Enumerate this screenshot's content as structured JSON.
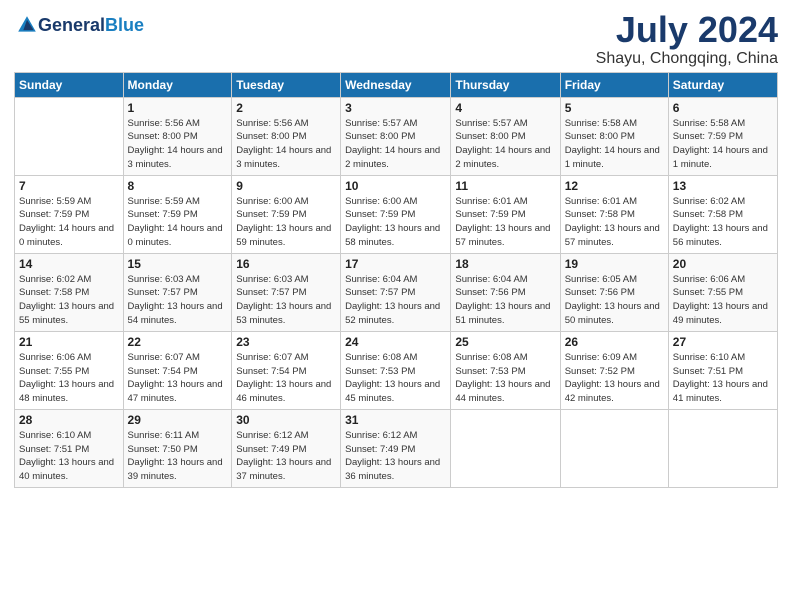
{
  "logo": {
    "text_general": "General",
    "text_blue": "Blue"
  },
  "title": "July 2024",
  "location": "Shayu, Chongqing, China",
  "days_of_week": [
    "Sunday",
    "Monday",
    "Tuesday",
    "Wednesday",
    "Thursday",
    "Friday",
    "Saturday"
  ],
  "weeks": [
    [
      {
        "day": "",
        "sunrise": "",
        "sunset": "",
        "daylight": ""
      },
      {
        "day": "1",
        "sunrise": "Sunrise: 5:56 AM",
        "sunset": "Sunset: 8:00 PM",
        "daylight": "Daylight: 14 hours and 3 minutes."
      },
      {
        "day": "2",
        "sunrise": "Sunrise: 5:56 AM",
        "sunset": "Sunset: 8:00 PM",
        "daylight": "Daylight: 14 hours and 3 minutes."
      },
      {
        "day": "3",
        "sunrise": "Sunrise: 5:57 AM",
        "sunset": "Sunset: 8:00 PM",
        "daylight": "Daylight: 14 hours and 2 minutes."
      },
      {
        "day": "4",
        "sunrise": "Sunrise: 5:57 AM",
        "sunset": "Sunset: 8:00 PM",
        "daylight": "Daylight: 14 hours and 2 minutes."
      },
      {
        "day": "5",
        "sunrise": "Sunrise: 5:58 AM",
        "sunset": "Sunset: 8:00 PM",
        "daylight": "Daylight: 14 hours and 1 minute."
      },
      {
        "day": "6",
        "sunrise": "Sunrise: 5:58 AM",
        "sunset": "Sunset: 7:59 PM",
        "daylight": "Daylight: 14 hours and 1 minute."
      }
    ],
    [
      {
        "day": "7",
        "sunrise": "Sunrise: 5:59 AM",
        "sunset": "Sunset: 7:59 PM",
        "daylight": "Daylight: 14 hours and 0 minutes."
      },
      {
        "day": "8",
        "sunrise": "Sunrise: 5:59 AM",
        "sunset": "Sunset: 7:59 PM",
        "daylight": "Daylight: 14 hours and 0 minutes."
      },
      {
        "day": "9",
        "sunrise": "Sunrise: 6:00 AM",
        "sunset": "Sunset: 7:59 PM",
        "daylight": "Daylight: 13 hours and 59 minutes."
      },
      {
        "day": "10",
        "sunrise": "Sunrise: 6:00 AM",
        "sunset": "Sunset: 7:59 PM",
        "daylight": "Daylight: 13 hours and 58 minutes."
      },
      {
        "day": "11",
        "sunrise": "Sunrise: 6:01 AM",
        "sunset": "Sunset: 7:59 PM",
        "daylight": "Daylight: 13 hours and 57 minutes."
      },
      {
        "day": "12",
        "sunrise": "Sunrise: 6:01 AM",
        "sunset": "Sunset: 7:58 PM",
        "daylight": "Daylight: 13 hours and 57 minutes."
      },
      {
        "day": "13",
        "sunrise": "Sunrise: 6:02 AM",
        "sunset": "Sunset: 7:58 PM",
        "daylight": "Daylight: 13 hours and 56 minutes."
      }
    ],
    [
      {
        "day": "14",
        "sunrise": "Sunrise: 6:02 AM",
        "sunset": "Sunset: 7:58 PM",
        "daylight": "Daylight: 13 hours and 55 minutes."
      },
      {
        "day": "15",
        "sunrise": "Sunrise: 6:03 AM",
        "sunset": "Sunset: 7:57 PM",
        "daylight": "Daylight: 13 hours and 54 minutes."
      },
      {
        "day": "16",
        "sunrise": "Sunrise: 6:03 AM",
        "sunset": "Sunset: 7:57 PM",
        "daylight": "Daylight: 13 hours and 53 minutes."
      },
      {
        "day": "17",
        "sunrise": "Sunrise: 6:04 AM",
        "sunset": "Sunset: 7:57 PM",
        "daylight": "Daylight: 13 hours and 52 minutes."
      },
      {
        "day": "18",
        "sunrise": "Sunrise: 6:04 AM",
        "sunset": "Sunset: 7:56 PM",
        "daylight": "Daylight: 13 hours and 51 minutes."
      },
      {
        "day": "19",
        "sunrise": "Sunrise: 6:05 AM",
        "sunset": "Sunset: 7:56 PM",
        "daylight": "Daylight: 13 hours and 50 minutes."
      },
      {
        "day": "20",
        "sunrise": "Sunrise: 6:06 AM",
        "sunset": "Sunset: 7:55 PM",
        "daylight": "Daylight: 13 hours and 49 minutes."
      }
    ],
    [
      {
        "day": "21",
        "sunrise": "Sunrise: 6:06 AM",
        "sunset": "Sunset: 7:55 PM",
        "daylight": "Daylight: 13 hours and 48 minutes."
      },
      {
        "day": "22",
        "sunrise": "Sunrise: 6:07 AM",
        "sunset": "Sunset: 7:54 PM",
        "daylight": "Daylight: 13 hours and 47 minutes."
      },
      {
        "day": "23",
        "sunrise": "Sunrise: 6:07 AM",
        "sunset": "Sunset: 7:54 PM",
        "daylight": "Daylight: 13 hours and 46 minutes."
      },
      {
        "day": "24",
        "sunrise": "Sunrise: 6:08 AM",
        "sunset": "Sunset: 7:53 PM",
        "daylight": "Daylight: 13 hours and 45 minutes."
      },
      {
        "day": "25",
        "sunrise": "Sunrise: 6:08 AM",
        "sunset": "Sunset: 7:53 PM",
        "daylight": "Daylight: 13 hours and 44 minutes."
      },
      {
        "day": "26",
        "sunrise": "Sunrise: 6:09 AM",
        "sunset": "Sunset: 7:52 PM",
        "daylight": "Daylight: 13 hours and 42 minutes."
      },
      {
        "day": "27",
        "sunrise": "Sunrise: 6:10 AM",
        "sunset": "Sunset: 7:51 PM",
        "daylight": "Daylight: 13 hours and 41 minutes."
      }
    ],
    [
      {
        "day": "28",
        "sunrise": "Sunrise: 6:10 AM",
        "sunset": "Sunset: 7:51 PM",
        "daylight": "Daylight: 13 hours and 40 minutes."
      },
      {
        "day": "29",
        "sunrise": "Sunrise: 6:11 AM",
        "sunset": "Sunset: 7:50 PM",
        "daylight": "Daylight: 13 hours and 39 minutes."
      },
      {
        "day": "30",
        "sunrise": "Sunrise: 6:12 AM",
        "sunset": "Sunset: 7:49 PM",
        "daylight": "Daylight: 13 hours and 37 minutes."
      },
      {
        "day": "31",
        "sunrise": "Sunrise: 6:12 AM",
        "sunset": "Sunset: 7:49 PM",
        "daylight": "Daylight: 13 hours and 36 minutes."
      },
      {
        "day": "",
        "sunrise": "",
        "sunset": "",
        "daylight": ""
      },
      {
        "day": "",
        "sunrise": "",
        "sunset": "",
        "daylight": ""
      },
      {
        "day": "",
        "sunrise": "",
        "sunset": "",
        "daylight": ""
      }
    ]
  ]
}
